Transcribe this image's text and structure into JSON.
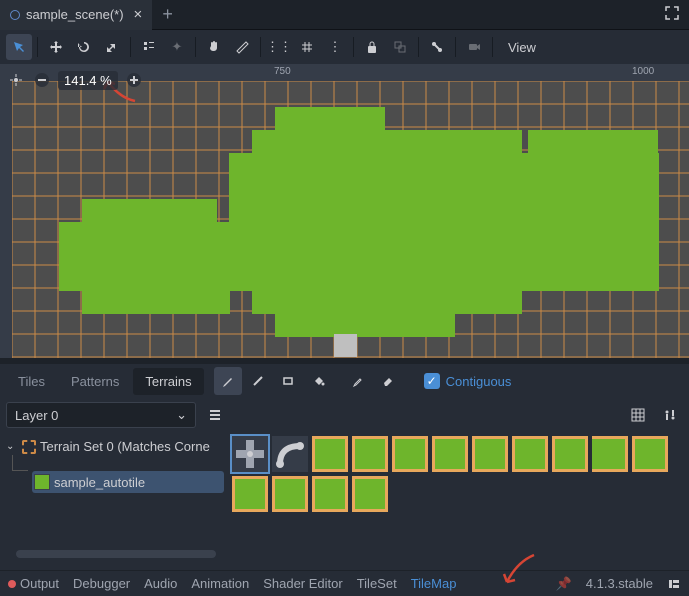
{
  "tab": {
    "title": "sample_scene(*)"
  },
  "ruler": {
    "m1": "750",
    "m2": "1000"
  },
  "zoom": {
    "value": "141.4 %"
  },
  "toolbar": {
    "view": "View"
  },
  "tilemap": {
    "tabs": {
      "tiles": "Tiles",
      "patterns": "Patterns",
      "terrains": "Terrains"
    },
    "contiguous": "Contiguous",
    "layer": "Layer 0",
    "terrain_set": "Terrain Set 0 (Matches Corne",
    "autotile": "sample_autotile"
  },
  "bottom": {
    "output": "Output",
    "debugger": "Debugger",
    "audio": "Audio",
    "animation": "Animation",
    "shader": "Shader Editor",
    "tileset": "TileSet",
    "tilemap": "TileMap",
    "version": "4.1.3.stable"
  }
}
